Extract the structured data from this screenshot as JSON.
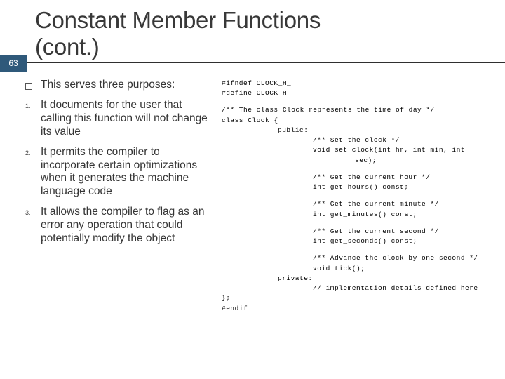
{
  "page_number": "63",
  "title_line1": "Constant Member Functions",
  "title_line2": "(cont.)",
  "bullets": {
    "intro": "This serves three purposes:",
    "num1": "1.",
    "item1": "It documents for the user that calling this function will not change its value",
    "num2": "2.",
    "item2": "It permits the compiler to incorporate certain optimizations when it generates the machine language code",
    "num3": "3.",
    "item3": "It allows the compiler to flag as an error any operation that could potentially modify the object"
  },
  "code": {
    "l1": "#ifndef CLOCK_H_",
    "l2": "#define CLOCK_H_",
    "l3": "/** The class Clock represents the time of day */",
    "l4": "class Clock {",
    "l5": "public:",
    "l6": "/** Set the clock */",
    "l7a": "void set_clock(int hr, int min, int",
    "l7b": "sec);",
    "l8": "/** Get the current hour */",
    "l9": "int get_hours() const;",
    "l10": "/** Get the current minute */",
    "l11": "int get_minutes() const;",
    "l12": "/** Get the current second */",
    "l13": "int get_seconds() const;",
    "l14": "/** Advance the clock by one second */",
    "l15": "void tick();",
    "l16": "private:",
    "l17": "// implementation details defined here",
    "l18": "};",
    "l19": "#endif"
  }
}
